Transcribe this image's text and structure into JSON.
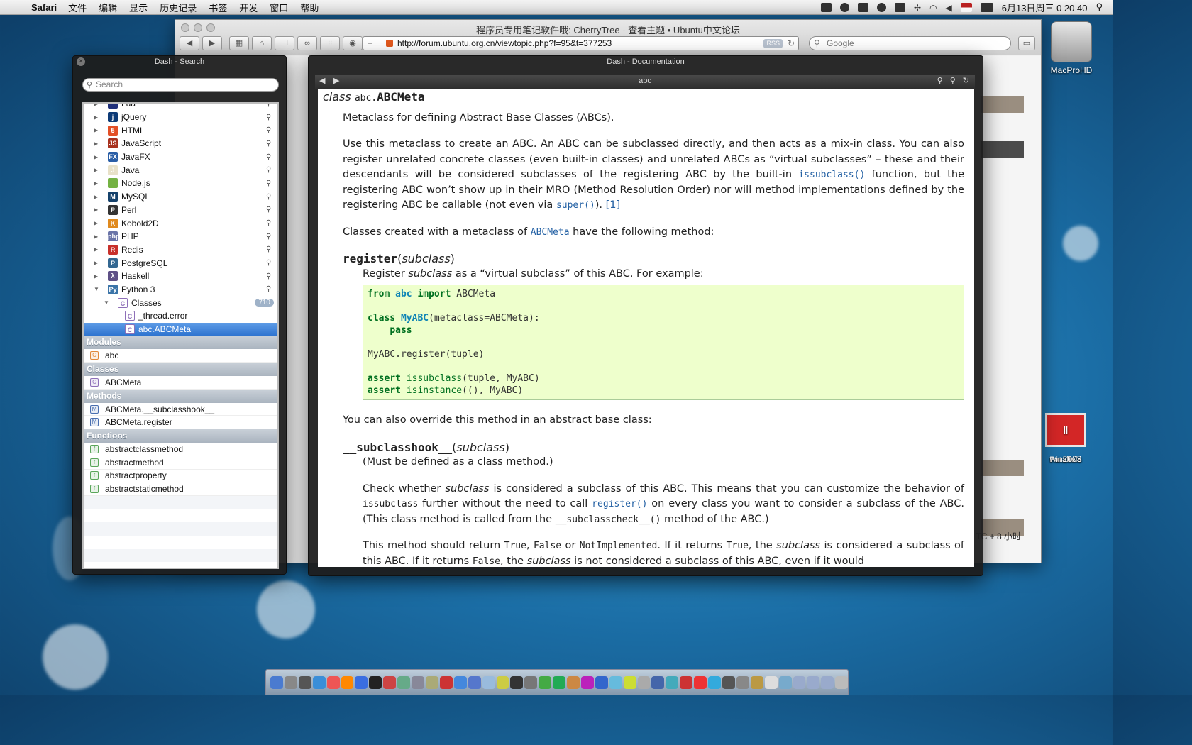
{
  "menubar": {
    "app": "Safari",
    "items": [
      "文件",
      "编辑",
      "显示",
      "历史记录",
      "书签",
      "开发",
      "窗口",
      "帮助"
    ],
    "clock": "6月13日周三  0 20 40"
  },
  "desktop": {
    "hd_label": "MacProHD",
    "vm_label": "win2003",
    "vm_brand": "|| Parallels"
  },
  "safari": {
    "title": "程序员专用笔记软件哦: CherryTree - 查看主题 • Ubuntu中文论坛",
    "url": "http://forum.ubuntu.org.cn/viewtopic.php?f=95&t=377253",
    "rss": "RSS",
    "search_placeholder": "Google",
    "web_note": "TC + 8 小时"
  },
  "dash_search": {
    "title": "Dash - Search",
    "search_placeholder": "Search",
    "docsets": [
      {
        "label": "Lua",
        "color": "#1f2f7a",
        "glyph": ""
      },
      {
        "label": "jQuery",
        "color": "#0d3b77",
        "glyph": "j"
      },
      {
        "label": "HTML",
        "color": "#e34f26",
        "glyph": "5"
      },
      {
        "label": "JavaScript",
        "color": "#a8321f",
        "glyph": "JS"
      },
      {
        "label": "JavaFX",
        "color": "#2a5ea6",
        "glyph": "FX"
      },
      {
        "label": "Java",
        "color": "#e8e1c8",
        "glyph": "J"
      },
      {
        "label": "Node.js",
        "color": "#74b243",
        "glyph": ""
      },
      {
        "label": "MySQL",
        "color": "#15416b",
        "glyph": "M"
      },
      {
        "label": "Perl",
        "color": "#333333",
        "glyph": "P"
      },
      {
        "label": "Kobold2D",
        "color": "#e08a1e",
        "glyph": "K"
      },
      {
        "label": "PHP",
        "color": "#6a74a8",
        "glyph": "php"
      },
      {
        "label": "Redis",
        "color": "#c8302a",
        "glyph": "R"
      },
      {
        "label": "PostgreSQL",
        "color": "#336791",
        "glyph": "P"
      },
      {
        "label": "Haskell",
        "color": "#5e5086",
        "glyph": "λ"
      },
      {
        "label": "Python 3",
        "color": "#3b74a8",
        "glyph": "Py"
      }
    ],
    "tree": {
      "classes_label": "Classes",
      "classes_count": "710",
      "items": [
        "_thread.error",
        "abc.ABCMeta"
      ]
    },
    "sections": [
      {
        "heading": "Modules",
        "icon": "C",
        "color": "#e0883a",
        "items": [
          "abc"
        ]
      },
      {
        "heading": "Classes",
        "icon": "C",
        "color": "#8e6fb8",
        "items": [
          "ABCMeta"
        ]
      },
      {
        "heading": "Methods",
        "icon": "M",
        "color": "#4a6fb0",
        "items": [
          "ABCMeta.__subclasshook__",
          "ABCMeta.register"
        ]
      },
      {
        "heading": "Functions",
        "icon": "f",
        "color": "#5aa65a",
        "items": [
          "abstractclassmethod",
          "abstractmethod",
          "abstractproperty",
          "abstractstaticmethod"
        ]
      }
    ]
  },
  "dash_doc": {
    "title": "Dash - Documentation",
    "page_title": "abc",
    "sig_prefix": "class",
    "sig_module": "abc.",
    "sig_name": "ABCMeta",
    "p1": "Metaclass for defining Abstract Base Classes (ABCs).",
    "p2a": "Use this metaclass to create an ABC. An ABC can be subclassed directly, and then acts as a mix-in class. You can also register unrelated concrete classes (even built-in classes) and unrelated ABCs as “virtual subclasses” – these and their descendants will be considered subclasses of the registering ABC by the built-in ",
    "p2_issubclass": "issubclass()",
    "p2b": " function, but the registering ABC won’t show up in their MRO (Method Resolution Order) nor will method implementations defined by the registering ABC be callable (not even via ",
    "p2_super": "super()",
    "p2c": "). ",
    "p2_ref": "[1]",
    "p3a": "Classes created with a metaclass of ",
    "p3_link": "ABCMeta",
    "p3b": " have the following method:",
    "register_name": "register",
    "register_arg": "subclass",
    "register_desc_a": "Register ",
    "register_desc_em": "subclass",
    "register_desc_b": " as a “virtual subclass” of this ABC. For example:",
    "code": {
      "l1_kw1": "from",
      "l1_mod": "abc",
      "l1_kw2": "import",
      "l1_rest": " ABCMeta",
      "l2_kw": "class",
      "l2_name": "MyABC",
      "l2_rest": "(metaclass=ABCMeta):",
      "l3_kw": "pass",
      "l4": "MyABC.register(tuple)",
      "l5_kw": "assert",
      "l5_fn": "issubclass",
      "l5_rest": "(tuple, MyABC)",
      "l6_kw": "assert",
      "l6_fn": "isinstance",
      "l6_rest": "((), MyABC)"
    },
    "p4": "You can also override this method in an abstract base class:",
    "hook_name": "__subclasshook__",
    "hook_arg": "subclass",
    "hook_note": "(Must be defined as a class method.)",
    "p5a": "Check whether ",
    "p5_em": "subclass",
    "p5b": " is considered a subclass of this ABC. This means that you can customize the behavior of ",
    "p5_code1": "issubclass",
    "p5c": " further without the need to call ",
    "p5_link": "register()",
    "p5d": " on every class you want to consider a subclass of the ABC. (This class method is called from the ",
    "p5_code2": "__subclasscheck__()",
    "p5e": " method of the ABC.)",
    "p6a": "This method should return ",
    "p6_true": "True",
    "p6_c1": ", ",
    "p6_false": "False",
    "p6_or": " or ",
    "p6_ni": "NotImplemented",
    "p6b": ". If it returns ",
    "p6_true2": "True",
    "p6c": ", the ",
    "p6_em": "subclass",
    "p6d": " is considered a subclass of this ABC. If it returns ",
    "p6_false2": "False",
    "p6e": ", the ",
    "p6_em2": "subclass",
    "p6f": " is not considered a subclass of this ABC, even if it would"
  }
}
